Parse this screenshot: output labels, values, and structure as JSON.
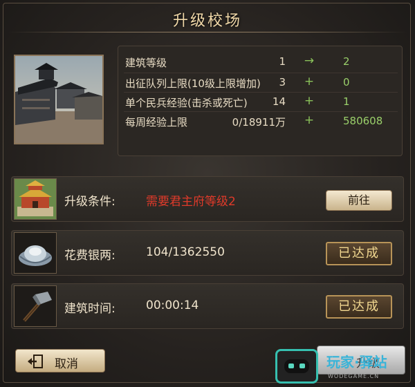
{
  "title": "升级校场",
  "stats": [
    {
      "label": "建筑等级",
      "current": "1",
      "op": "→",
      "next": "2"
    },
    {
      "label": "出征队列上限(10级上限增加)",
      "current": "3",
      "op": "+",
      "next": "0"
    },
    {
      "label": "单个民兵经验(击杀或死亡)",
      "current": "14",
      "op": "+",
      "next": "1"
    },
    {
      "label": "每周经验上限",
      "current": "0/18911万",
      "op": "+",
      "next": "580608"
    }
  ],
  "requirements": [
    {
      "label": "升级条件:",
      "value": "需要君主府等级2",
      "value_color": "#e03a2a",
      "button": "前往",
      "icon": "palace-icon"
    },
    {
      "label": "花费银两:",
      "value": "104/1362550",
      "button": "已达成",
      "icon": "silver-ingot-icon"
    },
    {
      "label": "建筑时间:",
      "value": "00:00:14",
      "button": "已达成",
      "icon": "hammer-icon"
    }
  ],
  "buttons": {
    "cancel": "取消",
    "upgrade": "升级"
  },
  "watermark": {
    "text": "玩家·驿站",
    "domain": "WODEGAME.CN"
  },
  "colors": {
    "accent_green": "#8ac25a",
    "warning_red": "#e03a2a",
    "gold": "#f2d890"
  }
}
